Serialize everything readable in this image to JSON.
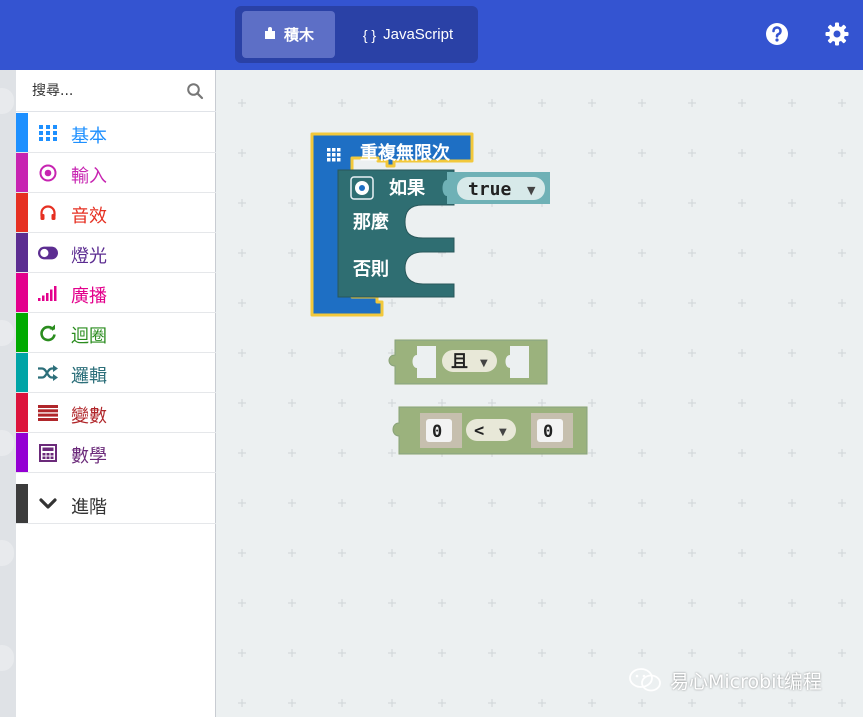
{
  "header": {
    "tabs": [
      {
        "label": "積木",
        "icon": "puzzle-icon",
        "active": true
      },
      {
        "label": "JavaScript",
        "icon": "braces-icon",
        "active": false
      }
    ],
    "help_icon": "question-circle-icon",
    "settings_icon": "gear-icon",
    "bar_color": "#3454d1"
  },
  "toolbox": {
    "search_placeholder": "搜尋...",
    "categories": [
      {
        "label": "基本",
        "color": "#1e90ff",
        "icon": "grid-icon"
      },
      {
        "label": "輸入",
        "color": "#c724b1",
        "icon": "target-icon"
      },
      {
        "label": "音效",
        "color": "#e63022",
        "icon": "headphones-icon"
      },
      {
        "label": "燈光",
        "color": "#5c2d91",
        "icon": "toggle-icon"
      },
      {
        "label": "廣播",
        "color": "#e3008c",
        "icon": "signal-icon"
      },
      {
        "label": "迴圈",
        "color": "#00aa00",
        "icon": "refresh-icon"
      },
      {
        "label": "邏輯",
        "color": "#00a4a6",
        "icon": "shuffle-icon"
      },
      {
        "label": "變數",
        "color": "#dc143c",
        "icon": "list-icon"
      },
      {
        "label": "數學",
        "color": "#9400d3",
        "icon": "calculator-icon"
      },
      {
        "label": "進階",
        "color": "#3c3c3c",
        "icon": "chevron-down-icon"
      }
    ]
  },
  "workspace": {
    "blocks": {
      "forever_label": "重複無限次",
      "if_label": "如果",
      "if_value": "true",
      "then_label": "那麼",
      "else_label": "否則",
      "and_label": "且",
      "compare_left": "0",
      "compare_op": "<",
      "compare_right": "0"
    },
    "watermark": "易心Microbit编程"
  }
}
